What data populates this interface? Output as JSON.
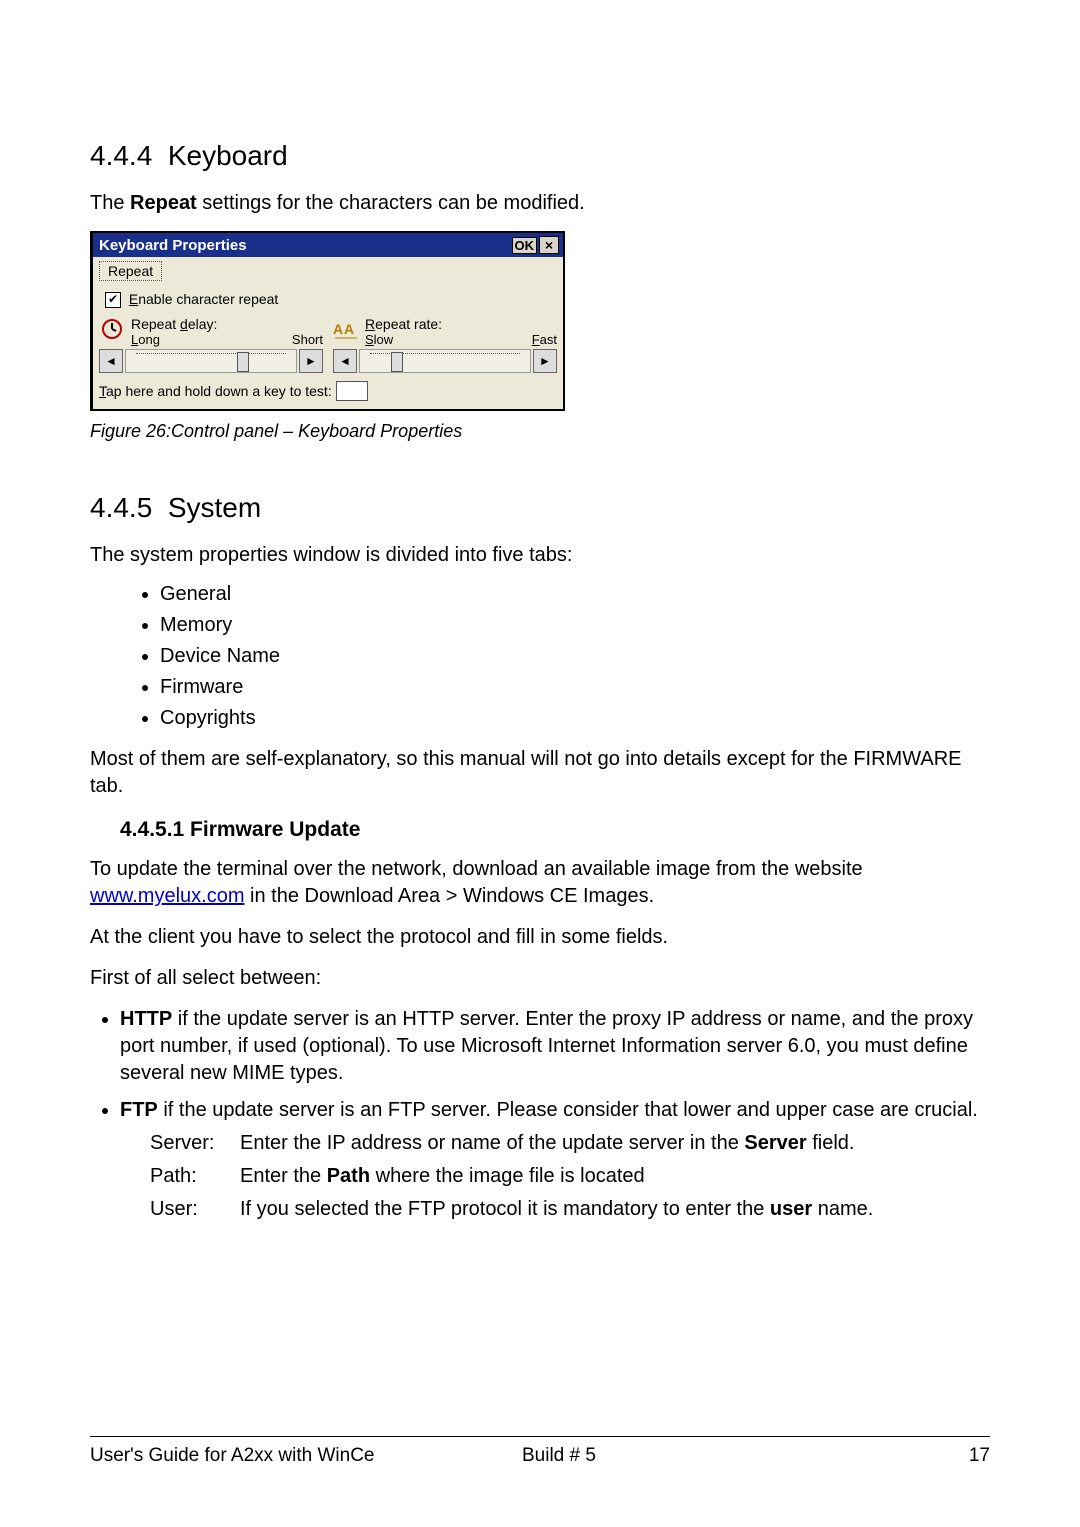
{
  "section_keyboard": {
    "number": "4.4.4",
    "title": "Keyboard",
    "intro_pre": "The ",
    "intro_bold": "Repeat",
    "intro_post": " settings for the characters can be modified."
  },
  "dialog": {
    "title": "Keyboard Properties",
    "ok": "OK",
    "close": "×",
    "tab": "Repeat",
    "enable_pre": "E",
    "enable_post": "nable character repeat",
    "delay": {
      "label_pre": "Repeat ",
      "label_u": "d",
      "label_post": "elay:",
      "left_pre": "L",
      "left_post": "ong",
      "right": "Short"
    },
    "rate": {
      "label_pre": "R",
      "label_post": "epeat rate:",
      "left_pre": "S",
      "left_post": "low",
      "right_pre": "F",
      "right_post": "ast"
    },
    "test_pre": "T",
    "test_post": "ap here and hold down a key to test:"
  },
  "figure_caption": "Figure 26:Control panel – Keyboard Properties",
  "section_system": {
    "number": "4.4.5",
    "title": "System",
    "intro": "The system properties window is divided into five tabs:",
    "tabs": [
      "General",
      "Memory",
      "Device Name",
      "Firmware",
      "Copyrights"
    ],
    "note": "Most of them are self-explanatory, so this manual will not go into details except for the FIRMWARE tab."
  },
  "firmware": {
    "heading": "4.4.5.1  Firmware Update",
    "p1_pre": "To update the terminal over the network, download an available image from the website ",
    "link_text": "www.myelux.com",
    "p1_post": " in the Download Area > Windows CE Images.",
    "p2": "At the client you have to select the protocol and fill in some fields.",
    "p3": "First of all select between:",
    "http_bold": "HTTP",
    "http_rest": " if the update server is an HTTP server. Enter the proxy IP address or name, and the proxy port number, if used (optional). To use Microsoft Internet Information server 6.0, you must define several new MIME types.",
    "ftp_bold": "FTP",
    "ftp_rest": " if the update server is an FTP server. Please consider that lower and upper case are crucial.",
    "fields": {
      "server": {
        "label": "Server:",
        "pre": "Enter the IP address or name of the update server in the ",
        "bold": "Server",
        "post": " field."
      },
      "path": {
        "label": "Path:",
        "pre": "Enter the ",
        "bold": "Path",
        "post": " where the image file is located"
      },
      "user": {
        "label": "User:",
        "pre": "If you selected the FTP protocol it is mandatory to enter the ",
        "bold": "user",
        "post": " name."
      }
    }
  },
  "footer": {
    "left": "User's Guide for A2xx with WinCe",
    "mid": "Build # 5",
    "right": "17"
  }
}
